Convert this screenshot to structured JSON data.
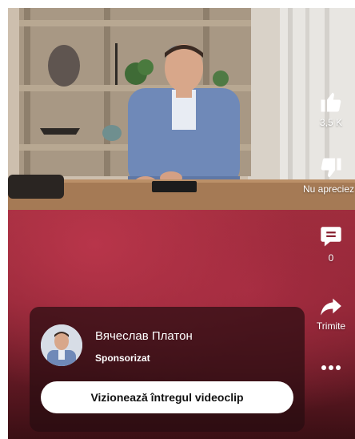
{
  "video": {
    "description_label": "video-frame"
  },
  "actions": {
    "like_count": "3,5 K",
    "dislike_label": "Nu apreciez",
    "comment_count": "0",
    "share_label": "Trimite"
  },
  "ad": {
    "channel_name": "Вячеслав Платон",
    "sponsored_label": "Sponsorizat",
    "cta_label": "Vizionează întregul videoclip"
  },
  "colors": {
    "accent_bg": "#8a2433",
    "card_bg": "#280c10",
    "cta_bg": "#ffffff"
  }
}
